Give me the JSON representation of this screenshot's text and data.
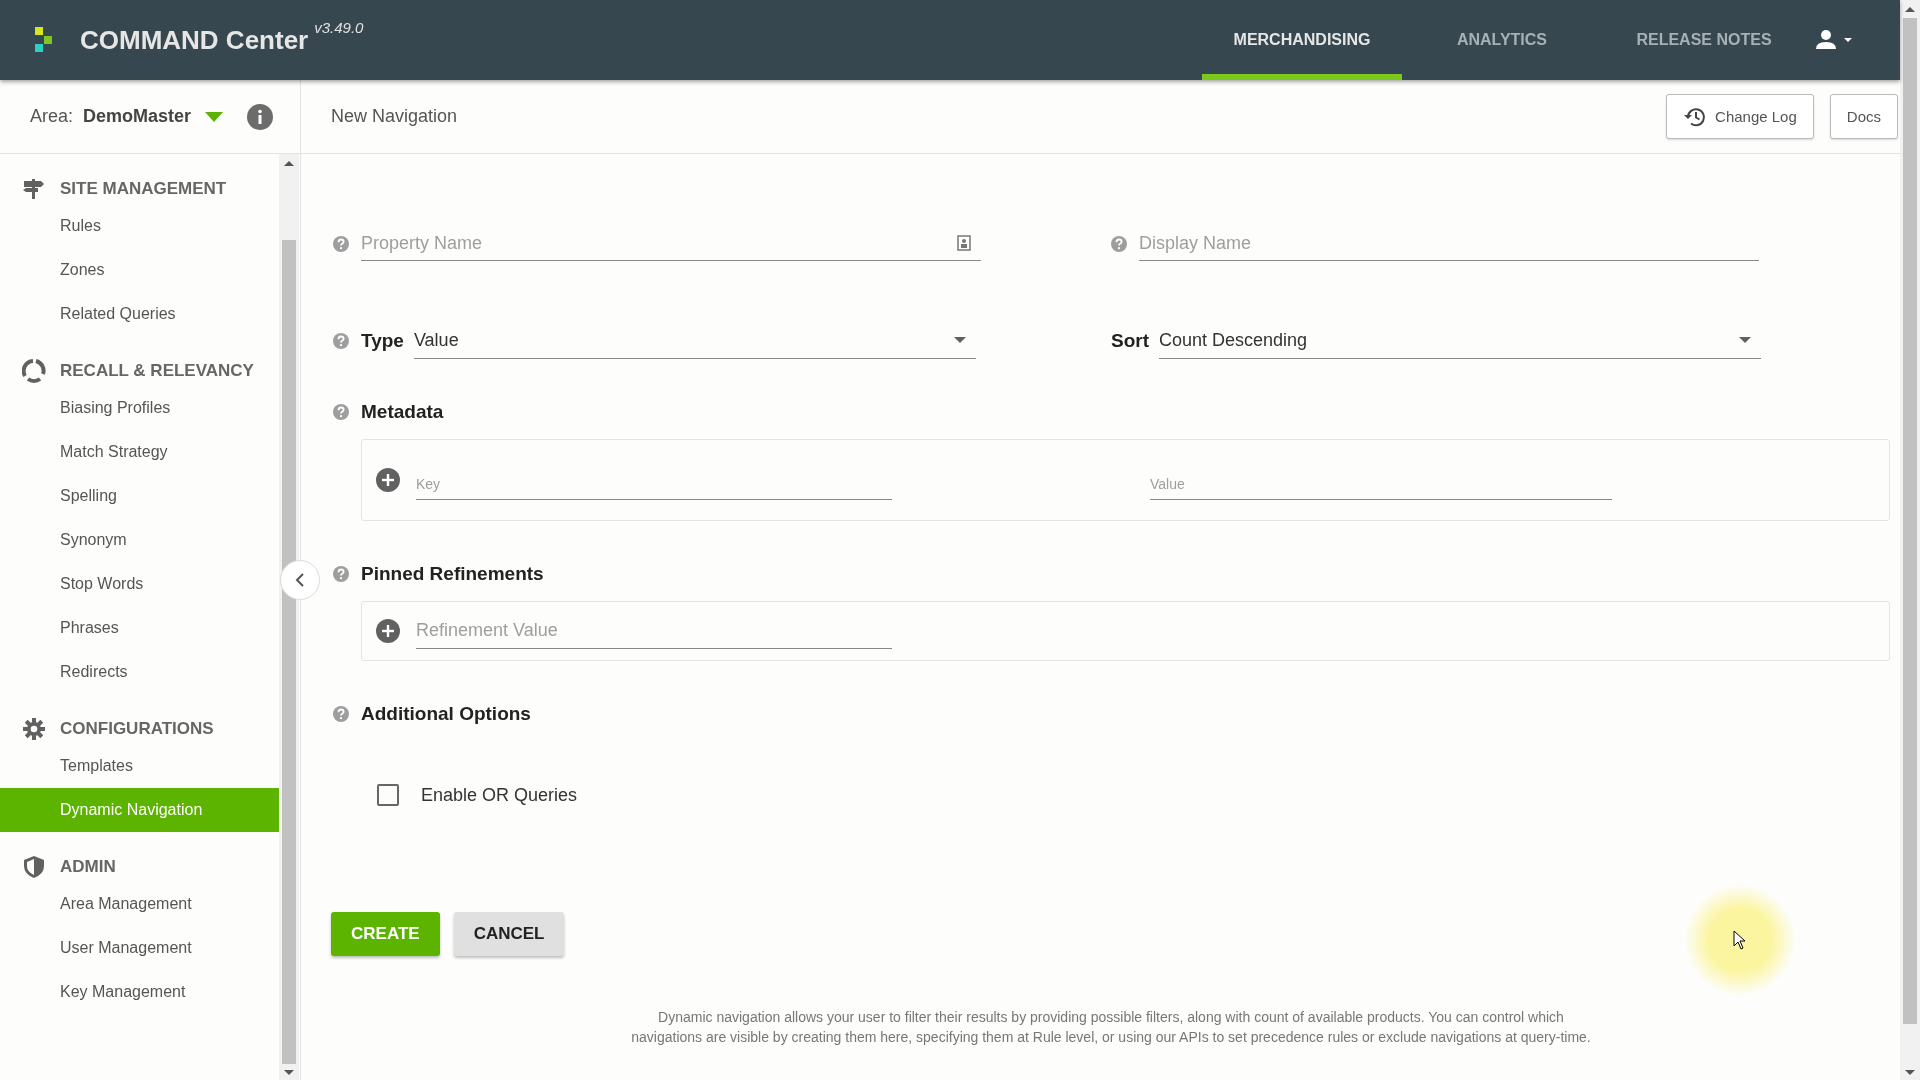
{
  "header": {
    "title": "COMMAND Center",
    "version": "v3.49.0",
    "nav": [
      {
        "label": "MERCHANDISING",
        "selected": true
      },
      {
        "label": "ANALYTICS",
        "selected": false
      },
      {
        "label": "RELEASE NOTES",
        "selected": false
      }
    ]
  },
  "area": {
    "label": "Area:",
    "value": "DemoMaster"
  },
  "page_title": "New Navigation",
  "toolbar_buttons": [
    {
      "label": "Change Log",
      "kind": "history"
    },
    {
      "label": "Docs",
      "kind": "plain"
    }
  ],
  "sidebar": {
    "sections": [
      {
        "title": "SITE MANAGEMENT",
        "kind": "signpost",
        "items": [
          {
            "label": "Rules",
            "selected": false
          },
          {
            "label": "Zones",
            "selected": false
          },
          {
            "label": "Related Queries",
            "selected": false
          }
        ]
      },
      {
        "title": "RECALL & RELEVANCY",
        "kind": "cycle",
        "items": [
          {
            "label": "Biasing Profiles",
            "selected": false
          },
          {
            "label": "Match Strategy",
            "selected": false
          },
          {
            "label": "Spelling",
            "selected": false
          },
          {
            "label": "Synonym",
            "selected": false
          },
          {
            "label": "Stop Words",
            "selected": false
          },
          {
            "label": "Phrases",
            "selected": false
          },
          {
            "label": "Redirects",
            "selected": false
          }
        ]
      },
      {
        "title": "CONFIGURATIONS",
        "kind": "gear",
        "items": [
          {
            "label": "Templates",
            "selected": false
          },
          {
            "label": "Dynamic Navigation",
            "selected": true
          }
        ]
      },
      {
        "title": "ADMIN",
        "kind": "shield",
        "items": [
          {
            "label": "Area Management",
            "selected": false
          },
          {
            "label": "User Management",
            "selected": false
          },
          {
            "label": "Key Management",
            "selected": false
          }
        ]
      }
    ]
  },
  "form": {
    "property_name": {
      "placeholder": "Property Name"
    },
    "display_name": {
      "placeholder": "Display Name"
    },
    "type": {
      "label": "Type",
      "value": "Value"
    },
    "sort": {
      "label": "Sort",
      "value": "Count Descending"
    },
    "metadata": {
      "title": "Metadata",
      "key_placeholder": "Key",
      "value_placeholder": "Value"
    },
    "pinned_refinements": {
      "title": "Pinned Refinements",
      "placeholder": "Refinement Value"
    },
    "additional_options": {
      "title": "Additional Options",
      "options": [
        {
          "label": "Enable OR Queries",
          "checked": false
        }
      ]
    }
  },
  "buttons": [
    {
      "label": "CREATE",
      "kind": "primary"
    },
    {
      "label": "CANCEL",
      "kind": "secondary"
    }
  ],
  "footer_note": "Dynamic navigation allows your user to filter their results by providing possible filters, along with count of available products. You can control which navigations are visible by creating them here, specifying them at Rule level, or using our APIs to set precedence rules or exclude navigations at query-time."
}
